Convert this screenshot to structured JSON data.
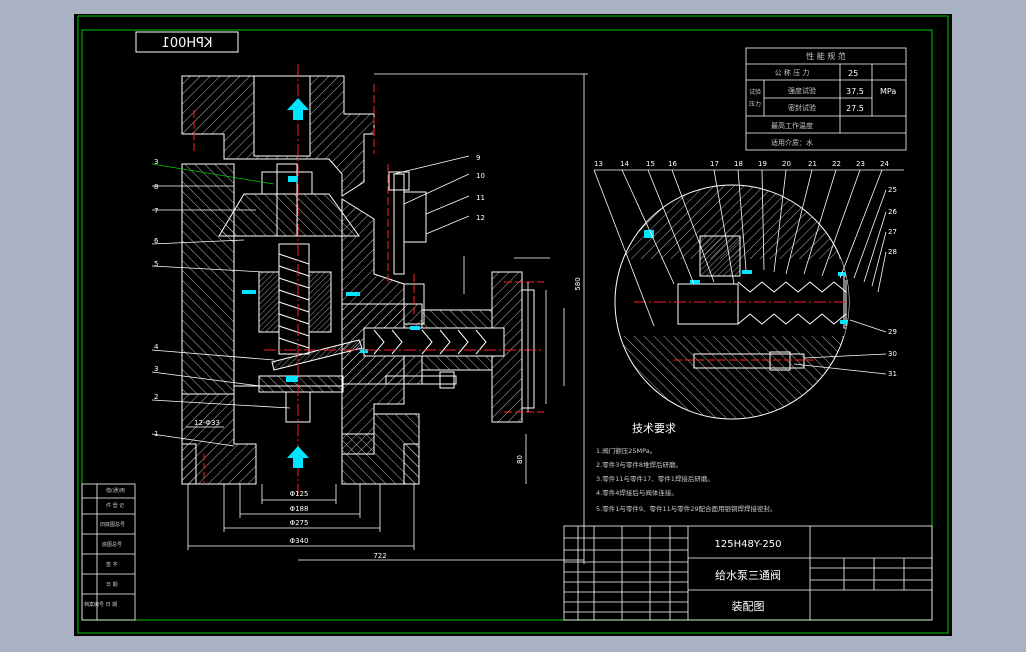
{
  "colors": {
    "background": "#a9b2c3",
    "sheet": "#000000",
    "border": "#00c800",
    "section_line": "#ffffff",
    "hatch": "#ffffff",
    "center_line": "#ff2020",
    "arrow": "#00e5ff",
    "dimension": "#ffffff",
    "title_text": "#ffffff"
  },
  "drawing": {
    "drawing_number_mirrored": "KPH001",
    "part_number_labels": [
      "1",
      "2",
      "3",
      "4",
      "5",
      "6",
      "7",
      "8",
      "9",
      "10",
      "11",
      "12"
    ],
    "detail_labels": [
      "13",
      "14",
      "15",
      "16",
      "17",
      "18",
      "19",
      "20",
      "21",
      "22",
      "23",
      "24",
      "25",
      "26",
      "27",
      "28",
      "29",
      "30",
      "31"
    ],
    "dimensions": {
      "d125": "Φ125",
      "d188": "Φ188",
      "d275": "Φ275",
      "d340": "Φ340",
      "total_width": "722",
      "height_right": "580",
      "bolt": "12-Φ33",
      "side_h": "80"
    }
  },
  "performance_table": {
    "title": "性 能 规 范",
    "rows": [
      {
        "label": "公 称 压 力",
        "value": "25",
        "unit": ""
      },
      {
        "label": "强度试验",
        "value": "37.5",
        "unit": "MPa"
      },
      {
        "label": "密封试验",
        "value": "27.5",
        "unit": ""
      },
      {
        "label": "最高工作温度",
        "value": "",
        "unit": ""
      },
      {
        "label": "适用介质：水",
        "value": "",
        "unit": ""
      }
    ],
    "side_label_1": "试验",
    "side_label_2": "压力"
  },
  "tech_requirements": {
    "title": "技术要求",
    "items": [
      "1.阀门额压25MPa。",
      "2.零件3与零件8堆焊后研磨。",
      "3.零件11与零件17、零件1焊接后研磨。",
      "4.零件4焊接后与阀体连接。",
      "5.零件1与零件9、零件11与零件29配合面用银铜焊焊接密封。"
    ]
  },
  "title_block": {
    "model": "125H48Y-250",
    "name": "给水泵三通阀",
    "drawing_type": "装配图"
  },
  "left_revision_block": {
    "rows": [
      "借(通)用",
      "件 登 记",
      "旧底图总号",
      "底图总号",
      "签 字",
      "日 期",
      "档案编号 日 期"
    ]
  }
}
